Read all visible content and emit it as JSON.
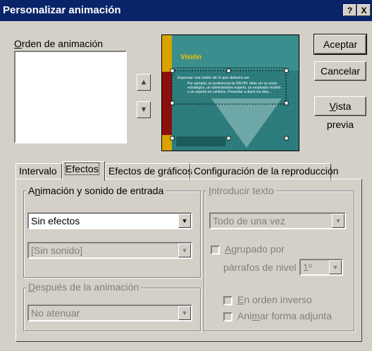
{
  "window": {
    "title": "Personalizar animación",
    "help_button": "?",
    "close_button": "X"
  },
  "order": {
    "label_pre": "",
    "label_u": "O",
    "label_post": "rden de animación"
  },
  "buttons": {
    "accept": "Aceptar",
    "cancel": "Cancelar",
    "preview_u": "V",
    "preview_rest": "ista previa"
  },
  "move_buttons": {
    "up_icon": "arrow-up",
    "down_icon": "arrow-down"
  },
  "slide_preview": {
    "title": "Visión",
    "bullet1": "Expresar una visión de lo que debería ser",
    "bullet2": "Por ejemplo, un profesional de RR.HH. debe ser un socio estratégico, un administrativo experto, un empleado modelo y un experto en cambios. Presentar a diario los días..."
  },
  "tabs": {
    "interval": "Intervalo",
    "effects": "Efectos",
    "chart_effects": "Efectos de gráficos",
    "playback": "Configuración de la reproducción"
  },
  "entry": {
    "group_pre": "A",
    "group_u": "n",
    "group_post": "imación y sonido de entrada",
    "effect_value": "Sin efectos",
    "sound_value": "[Sin sonido]"
  },
  "after": {
    "group_u": "D",
    "group_post": "espués de la animación",
    "value": "No atenuar"
  },
  "text": {
    "group_u": "I",
    "group_post": "ntroducir texto",
    "value": "Todo de una vez",
    "grouped_u": "A",
    "grouped_post": "grupado por",
    "level_label": "párrafos de nivel",
    "level_value": "1º",
    "reverse_u": "E",
    "reverse_post": "n orden inverso",
    "animate_pre": "Ani",
    "animate_u": "m",
    "animate_post": "ar forma adjunta"
  },
  "colors": {
    "titlebar": "#0a246a",
    "dialog": "#d4d0c8",
    "slide_teal": "#2e7f7f",
    "slide_accent": "#d9a300",
    "slide_title": "#f2c200"
  }
}
